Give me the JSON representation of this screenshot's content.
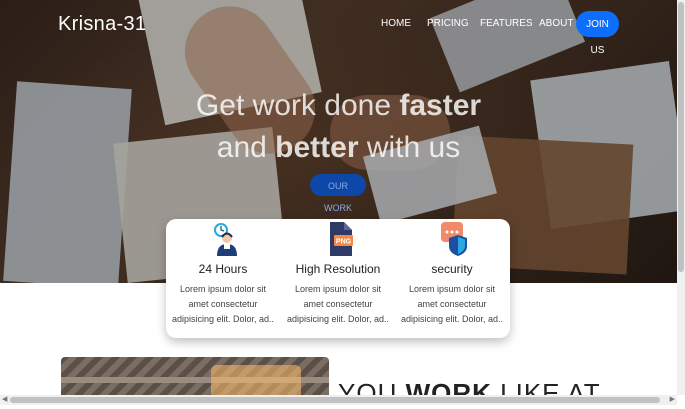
{
  "brand": {
    "name": "Krisna-31"
  },
  "nav": {
    "items": [
      "HOME",
      "PRICING",
      "FEATURES",
      "ABOUT"
    ],
    "cta": "JOIN US"
  },
  "hero": {
    "line1_light": "Get work done ",
    "line1_bold": "faster",
    "line2_light_a": "and ",
    "line2_bold": "better",
    "line2_light_b": " with us",
    "button": "OUR WORK"
  },
  "features": [
    {
      "icon": "clock-support-icon",
      "title": "24 Hours",
      "text": "Lorem ipsum dolor sit amet consectetur adipisicing elit. Dolor, ad.."
    },
    {
      "icon": "png-file-icon",
      "title": "High Resolution",
      "text": "Lorem ipsum dolor sit amet consectetur adipisicing elit. Dolor, ad.."
    },
    {
      "icon": "shield-chat-icon",
      "title": "security",
      "text": "Lorem ipsum dolor sit amet consectetur adipisicing elit. Dolor, ad.."
    }
  ],
  "section": {
    "title_light_a": "YOU ",
    "title_bold": "WORK",
    "title_light_b": " LIKE AT"
  },
  "colors": {
    "accent": "#0d6efd",
    "cta_dark": "#0d47a8"
  }
}
